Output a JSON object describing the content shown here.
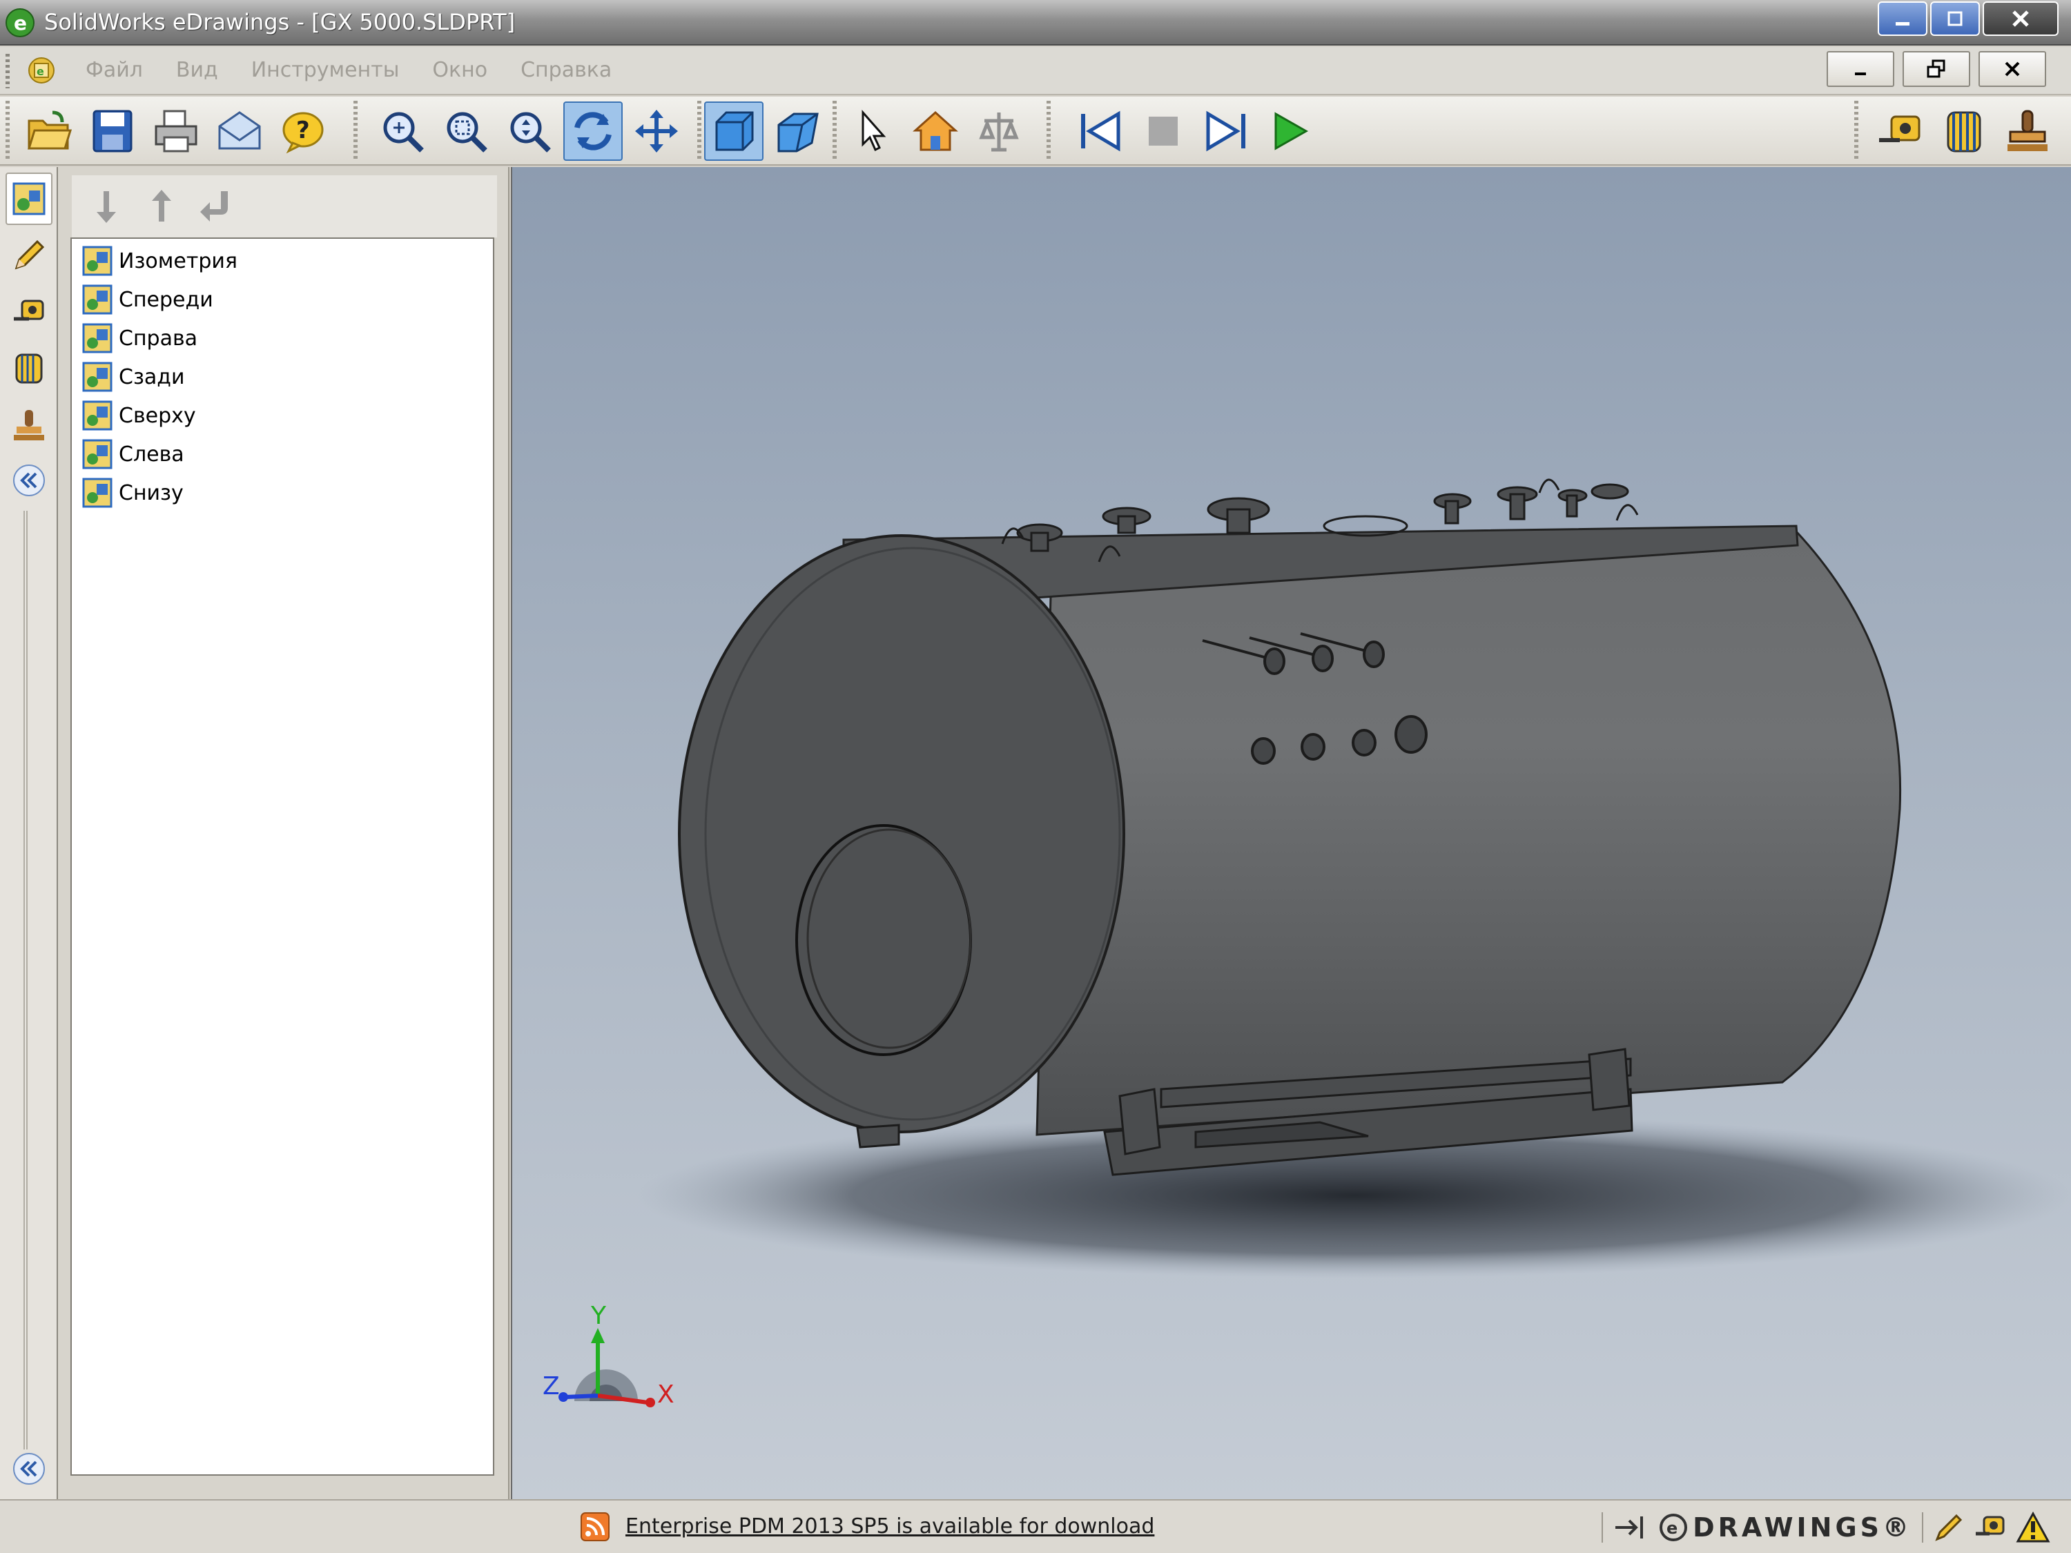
{
  "window": {
    "title": "SolidWorks eDrawings - [GX 5000.SLDPRT]"
  },
  "menu": {
    "items": [
      "Файл",
      "Вид",
      "Инструменты",
      "Окно",
      "Справка"
    ]
  },
  "toolbar": {
    "file_tools": [
      "open-icon",
      "save-icon",
      "print-icon",
      "email-icon",
      "help-icon"
    ],
    "view_tools": [
      "zoom-to-fit-icon",
      "zoom-to-area-icon",
      "zoom-in-out-icon",
      "rotate-icon",
      "pan-icon"
    ],
    "display_tools": [
      "shaded-icon",
      "perspective-icon"
    ],
    "select_tools": [
      "select-icon",
      "home-icon",
      "reset-icon"
    ],
    "playback_tools": [
      "previous-icon",
      "stop-icon",
      "next-icon",
      "play-icon"
    ],
    "right_tools": [
      "measure-icon",
      "section-icon",
      "stamp-icon"
    ]
  },
  "views_panel": {
    "items": [
      {
        "label": "Изометрия"
      },
      {
        "label": "Спереди"
      },
      {
        "label": "Справа"
      },
      {
        "label": "Сзади"
      },
      {
        "label": "Сверху"
      },
      {
        "label": "Слева"
      },
      {
        "label": "Снизу"
      }
    ]
  },
  "triad": {
    "x": "X",
    "y": "Y",
    "z": "Z"
  },
  "status": {
    "message": "Enterprise PDM 2013 SP5 is available for download",
    "brand": "DRAWINGS®"
  },
  "colors": {
    "viewport_top": "#8d9cb0",
    "viewport_bottom": "#c5ccd5",
    "model": "#5e6062",
    "active_tool": "#9fc4ea"
  }
}
